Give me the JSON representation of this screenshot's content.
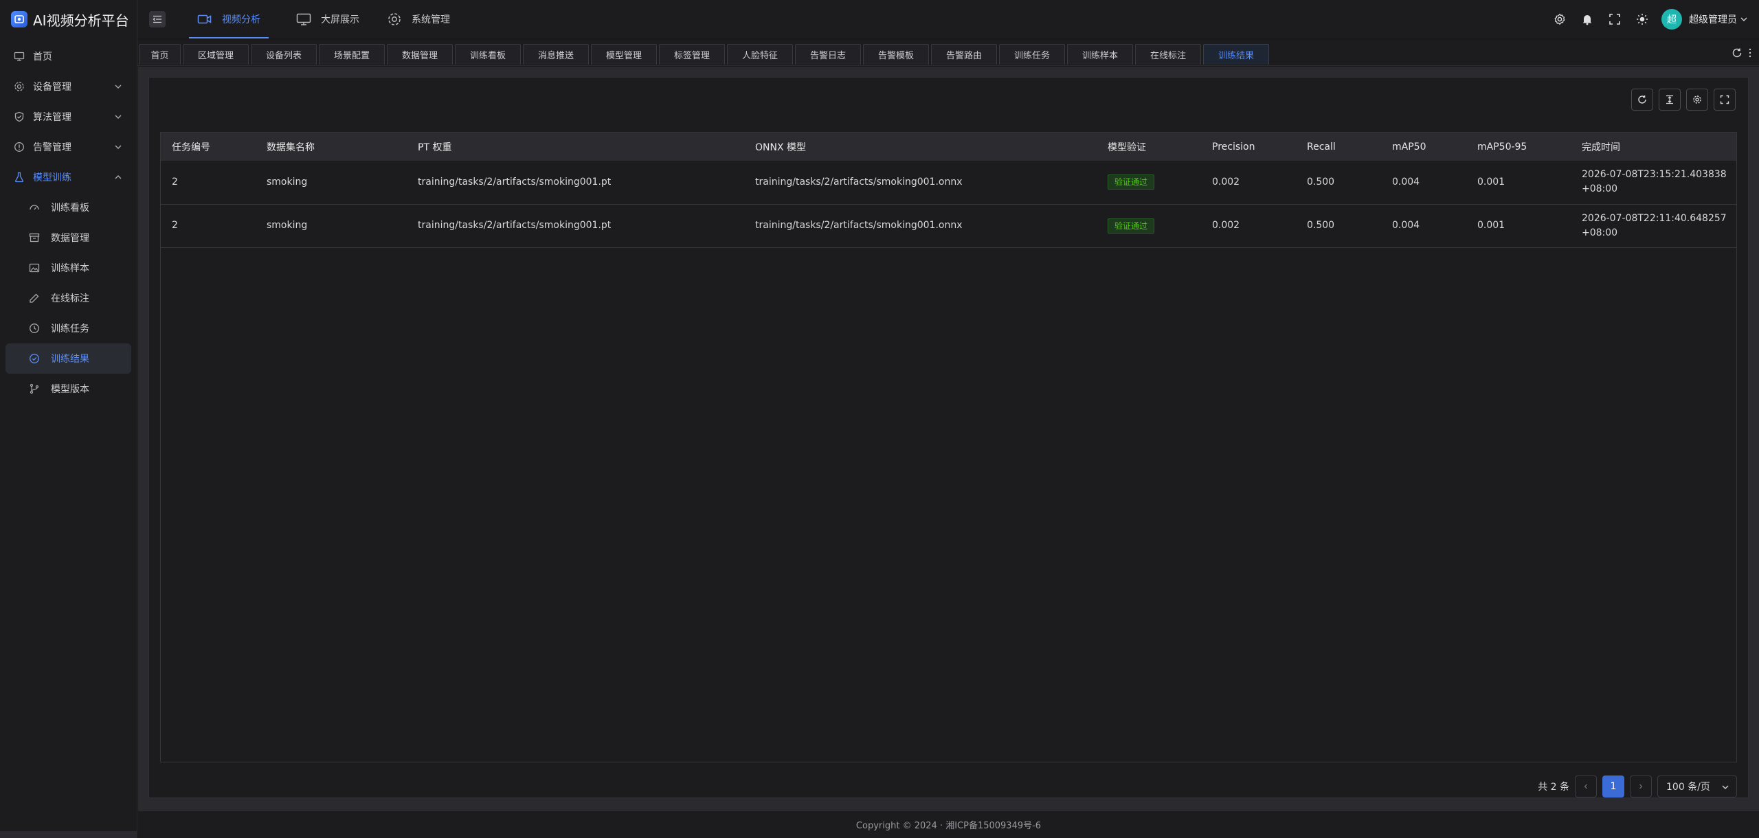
{
  "app": {
    "title": "AI视频分析平台",
    "logo_icon": "platform-logo-icon"
  },
  "sidebar": {
    "items": [
      {
        "label": "首页",
        "icon": "monitor-icon"
      },
      {
        "label": "设备管理",
        "icon": "gear-icon"
      },
      {
        "label": "算法管理",
        "icon": "shield-icon"
      },
      {
        "label": "告警管理",
        "icon": "alert-circle-icon"
      },
      {
        "label": "模型训练",
        "icon": "flask-icon"
      }
    ],
    "sub_items": [
      {
        "label": "训练看板",
        "icon": "dashboard-icon"
      },
      {
        "label": "数据管理",
        "icon": "archive-icon"
      },
      {
        "label": "训练样本",
        "icon": "image-icon"
      },
      {
        "label": "在线标注",
        "icon": "pencil-icon"
      },
      {
        "label": "训练任务",
        "icon": "clock-icon"
      },
      {
        "label": "训练结果",
        "icon": "check-circle-icon"
      },
      {
        "label": "模型版本",
        "icon": "git-branch-icon"
      }
    ]
  },
  "header": {
    "tabs": [
      {
        "label": "视频分析",
        "icon": "video-icon"
      },
      {
        "label": "大屏展示",
        "icon": "monitor-icon"
      },
      {
        "label": "系统管理",
        "icon": "gear-icon"
      }
    ],
    "avatar_char": "超",
    "user_name": "超级管理员"
  },
  "tabs": [
    "首页",
    "区域管理",
    "设备列表",
    "场景配置",
    "数据管理",
    "训练看板",
    "消息推送",
    "模型管理",
    "标签管理",
    "人脸特征",
    "告警日志",
    "告警模板",
    "告警路由",
    "训练任务",
    "训练样本",
    "在线标注",
    "训练结果"
  ],
  "table": {
    "headers": [
      "任务编号",
      "数据集名称",
      "PT 权重",
      "ONNX 模型",
      "模型验证",
      "Precision",
      "Recall",
      "mAP50",
      "mAP50-95",
      "完成时间"
    ],
    "rows": [
      [
        "2",
        "smoking",
        "training/tasks/2/artifacts/smoking001.pt",
        "training/tasks/2/artifacts/smoking001.onnx",
        "验证通过",
        "0.002",
        "0.500",
        "0.004",
        "0.001",
        "2026-07-08T23:15:21.403838+08:00"
      ],
      [
        "2",
        "smoking",
        "training/tasks/2/artifacts/smoking001.pt",
        "training/tasks/2/artifacts/smoking001.onnx",
        "验证通过",
        "0.002",
        "0.500",
        "0.004",
        "0.001",
        "2026-07-08T22:11:40.648257+08:00"
      ]
    ]
  },
  "pagination": {
    "total": "共 2 条",
    "current": "1",
    "page_size": "100 条/页"
  },
  "footer": "Copyright © 2024 · 湘ICP备15009349号-6",
  "colors": {
    "accent": "#5b8ef7",
    "success": "#52c41a",
    "avatar": "#1fb6b0"
  }
}
